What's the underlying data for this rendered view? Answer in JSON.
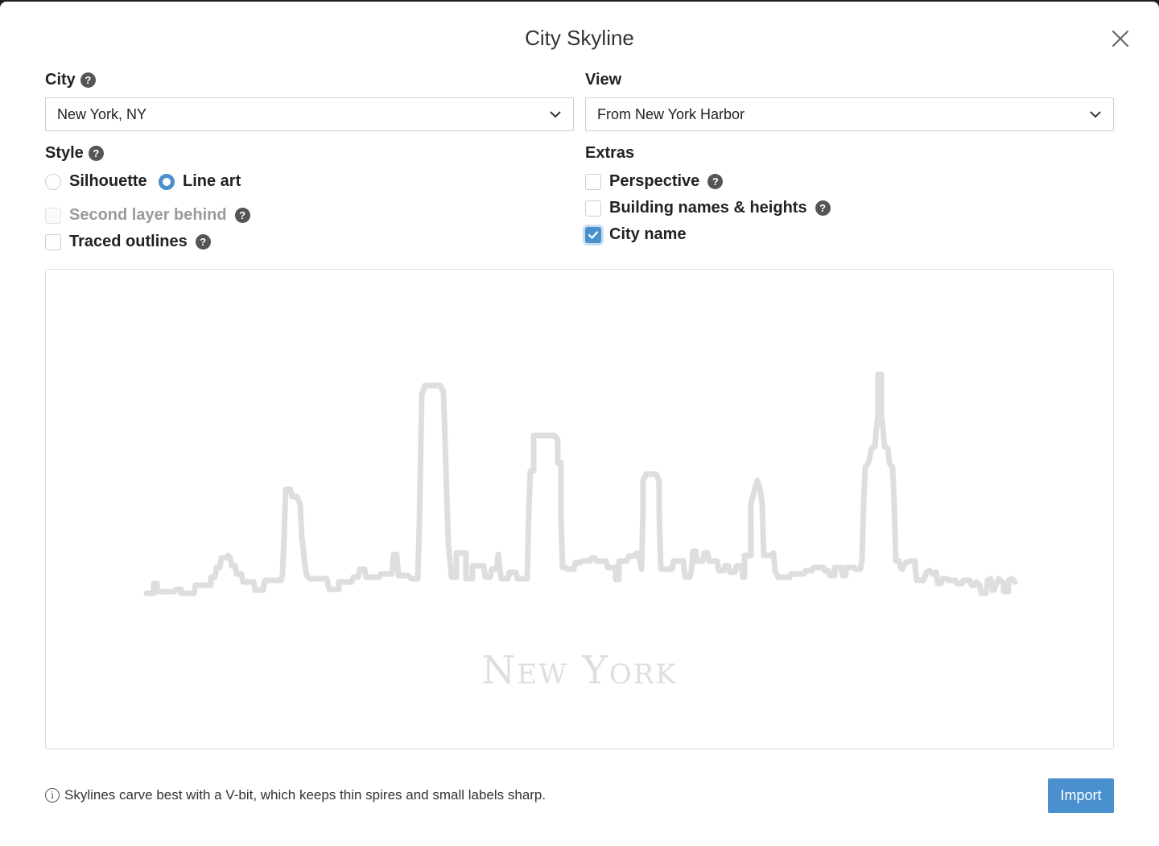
{
  "dialog": {
    "title": "City Skyline"
  },
  "city": {
    "label": "City",
    "value": "New York, NY"
  },
  "view": {
    "label": "View",
    "value": "From New York Harbor"
  },
  "style": {
    "label": "Style",
    "options": [
      {
        "label": "Silhouette",
        "selected": false
      },
      {
        "label": "Line art",
        "selected": true
      }
    ],
    "second_layer": {
      "label": "Second layer behind",
      "checked": false,
      "disabled": true
    },
    "traced_outlines": {
      "label": "Traced outlines",
      "checked": false
    }
  },
  "extras": {
    "label": "Extras",
    "perspective": {
      "label": "Perspective",
      "checked": false
    },
    "building_names": {
      "label": "Building names & heights",
      "checked": false
    },
    "city_name": {
      "label": "City name",
      "checked": true
    }
  },
  "preview": {
    "city_name_text": "New York"
  },
  "footer": {
    "info_text": "Skylines carve best with a V-bit, which keeps thin spires and small labels sharp.",
    "import_label": "Import"
  },
  "colors": {
    "accent": "#4a90cf",
    "skyline_stroke": "#dedede"
  },
  "icons": {
    "help": "?",
    "info": "i"
  }
}
